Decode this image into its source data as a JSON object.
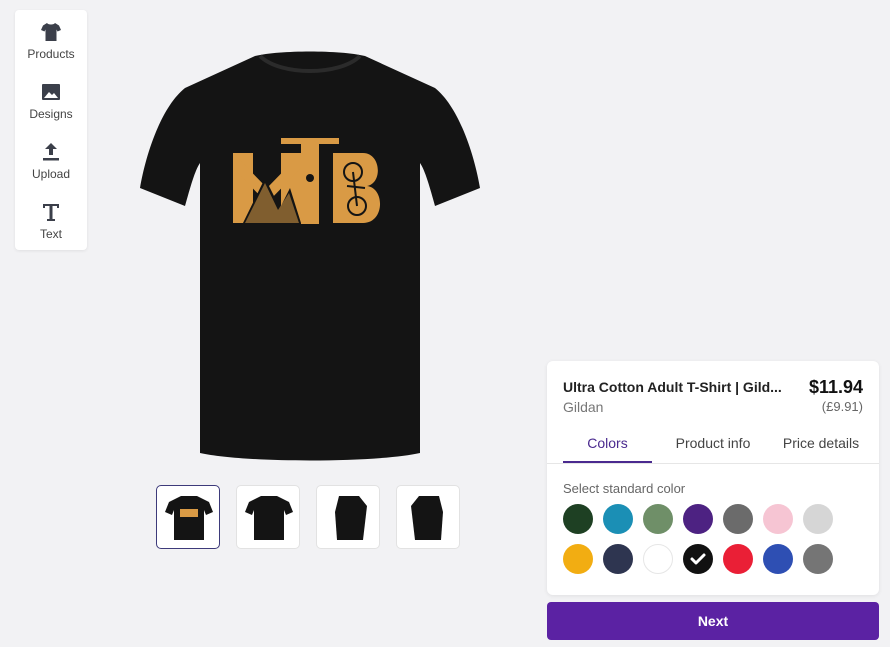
{
  "tools": [
    {
      "label": "Products",
      "icon": "tshirt-icon"
    },
    {
      "label": "Designs",
      "icon": "image-icon"
    },
    {
      "label": "Upload",
      "icon": "upload-icon"
    },
    {
      "label": "Text",
      "icon": "text-icon"
    }
  ],
  "design": {
    "text": "MTB",
    "color": "#d99a45"
  },
  "thumbnails": [
    "front-with-design",
    "front-plain",
    "side-left",
    "side-right"
  ],
  "product": {
    "name": "Ultra Cotton Adult T-Shirt | Gild...",
    "brand": "Gildan",
    "price": "$11.94",
    "price_alt": "(£9.91)"
  },
  "tabs": [
    "Colors",
    "Product info",
    "Price details"
  ],
  "active_tab": "Colors",
  "colors_label": "Select standard color",
  "colors_row1": [
    "#1e4023",
    "#1b8fb5",
    "#6f8f68",
    "#4d2282",
    "#6b6b6b",
    "#f6c5d3",
    "#d6d6d6"
  ],
  "colors_row2": [
    "#f2ad12",
    "#2e3550",
    "#ffffff",
    "#111111",
    "#ea1f36",
    "#2e4fb3",
    "#757575"
  ],
  "selected_color": "#111111",
  "next_label": "Next"
}
